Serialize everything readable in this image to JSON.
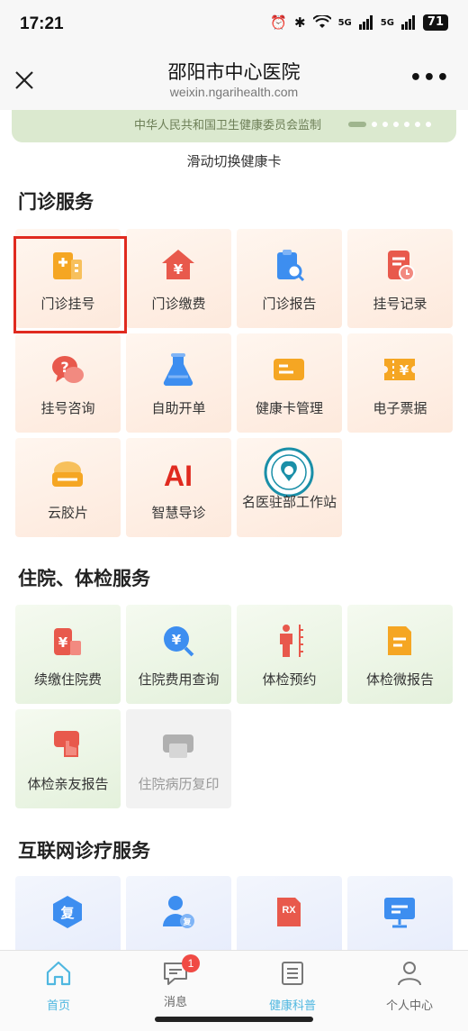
{
  "status": {
    "time": "17:21",
    "battery": "71",
    "signal1": "5G",
    "signal2": "5G"
  },
  "nav": {
    "title": "邵阳市中心医院",
    "url": "weixin.ngarihealth.com"
  },
  "banner": {
    "text": "中华人民共和国卫生健康委员会监制",
    "swipe_hint": "滑动切换健康卡"
  },
  "sections": {
    "outpatient": {
      "title": "门诊服务",
      "items": [
        {
          "label": "门诊挂号",
          "icon": "hospital-building-icon"
        },
        {
          "label": "门诊缴费",
          "icon": "yuan-house-icon"
        },
        {
          "label": "门诊报告",
          "icon": "clipboard-search-icon"
        },
        {
          "label": "挂号记录",
          "icon": "record-clock-icon"
        },
        {
          "label": "挂号咨询",
          "icon": "chat-question-icon"
        },
        {
          "label": "自助开单",
          "icon": "flask-icon"
        },
        {
          "label": "健康卡管理",
          "icon": "health-card-icon"
        },
        {
          "label": "电子票据",
          "icon": "ticket-yuan-icon"
        },
        {
          "label": "云胶片",
          "icon": "cloud-film-icon"
        },
        {
          "label": "智慧导诊",
          "icon": "ai-icon"
        },
        {
          "label": "名医驻部工作站",
          "icon": "hospital-logo-icon"
        }
      ]
    },
    "inpatient": {
      "title": "住院、体检服务",
      "items": [
        {
          "label": "续缴住院费",
          "icon": "yuan-bed-icon"
        },
        {
          "label": "住院费用查询",
          "icon": "yuan-search-icon"
        },
        {
          "label": "体检预约",
          "icon": "body-measure-icon"
        },
        {
          "label": "体检微报告",
          "icon": "report-doc-icon"
        },
        {
          "label": "体检亲友报告",
          "icon": "hand-tap-icon"
        },
        {
          "label": "住院病历复印",
          "icon": "printer-icon"
        }
      ]
    },
    "internet": {
      "title": "互联网诊疗服务",
      "items": [
        {
          "label": "复",
          "icon": "revisit-icon"
        },
        {
          "label": "复",
          "icon": "doctor-revisit-icon"
        },
        {
          "label": "RX",
          "icon": "prescription-icon"
        },
        {
          "label": "",
          "icon": "monitor-icon"
        }
      ]
    }
  },
  "tabs": [
    {
      "label": "首页",
      "icon": "home-icon"
    },
    {
      "label": "消息",
      "icon": "message-icon",
      "badge": "1"
    },
    {
      "label": "健康科普",
      "icon": "article-icon"
    },
    {
      "label": "个人中心",
      "icon": "user-icon"
    }
  ],
  "colors": {
    "accent": "#4fb7e0",
    "orange": "#f5a623",
    "red": "#e8594c",
    "blue": "#3d8ef0",
    "green_bg": "#e4f1dc"
  }
}
